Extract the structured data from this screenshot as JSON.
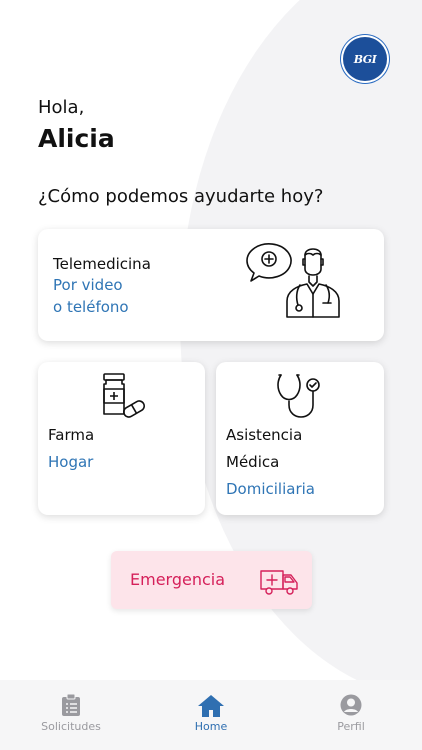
{
  "header": {
    "logo_text": "BGI",
    "greeting": "Hola,",
    "user_name": "Alicia",
    "question": "¿Cómo podemos ayudarte hoy?"
  },
  "cards": {
    "telemedicina": {
      "title": "Telemedicina",
      "line1": "Por video",
      "line2": "o teléfono",
      "icon": "doctor-icon"
    },
    "farma": {
      "title": "Farma",
      "subtitle": "Hogar",
      "icon": "medicine-bottle-icon"
    },
    "asistencia": {
      "title1": "Asistencia",
      "title2": "Médica",
      "subtitle": "Domiciliaria",
      "icon": "stethoscope-icon"
    },
    "emergencia": {
      "title": "Emergencia",
      "icon": "ambulance-icon"
    }
  },
  "tabbar": {
    "tabs": [
      {
        "label": "Solicitudes",
        "icon": "clipboard-icon",
        "active": false
      },
      {
        "label": "Home",
        "icon": "home-icon",
        "active": true
      },
      {
        "label": "Perfil",
        "icon": "user-icon",
        "active": false
      }
    ]
  },
  "colors": {
    "accent": "#2f75b5",
    "emergency_bg": "#fde4ea",
    "emergency_text": "#d5205a",
    "tab_inactive": "#9a9a9f"
  }
}
